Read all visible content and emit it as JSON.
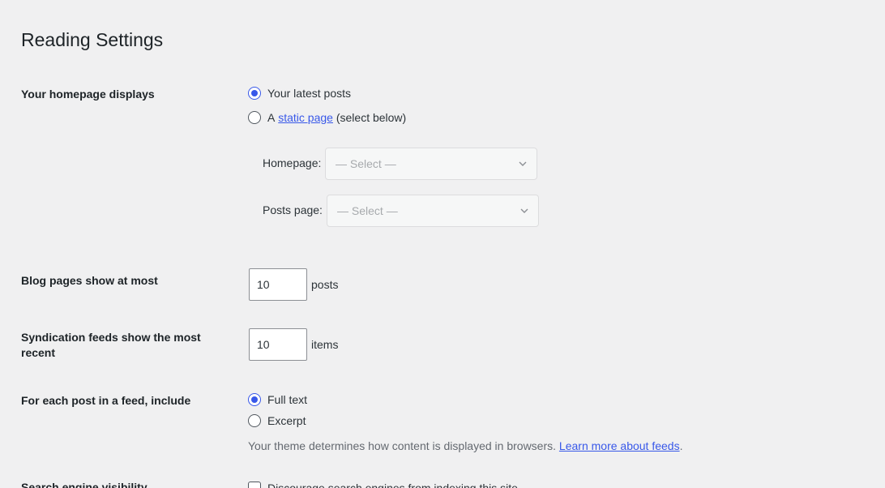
{
  "page_title": "Reading Settings",
  "homepage": {
    "label": "Your homepage displays",
    "option_latest": "Your latest posts",
    "option_static_prefix": "A",
    "option_static_link": "static page",
    "option_static_suffix": "(select below)",
    "homepage_label": "Homepage:",
    "homepage_select": "— Select —",
    "posts_page_label": "Posts page:",
    "posts_page_select": "— Select —",
    "selected": "latest"
  },
  "blog_pages": {
    "label": "Blog pages show at most",
    "value": "10",
    "unit": "posts"
  },
  "syndication": {
    "label": "Syndication feeds show the most recent",
    "value": "10",
    "unit": "items"
  },
  "feed_include": {
    "label": "For each post in a feed, include",
    "option_full": "Full text",
    "option_excerpt": "Excerpt",
    "selected": "full",
    "description": "Your theme determines how content is displayed in browsers.",
    "learn_more": "Learn more about feeds",
    "period": "."
  },
  "search_visibility": {
    "label": "Search engine visibility",
    "checkbox_label": "Discourage search engines from indexing this site",
    "checked": false
  },
  "colors": {
    "accent": "#3858e9",
    "background": "#f0f0f1"
  },
  "icons": {
    "select_chevron": "chevron-down-icon"
  }
}
